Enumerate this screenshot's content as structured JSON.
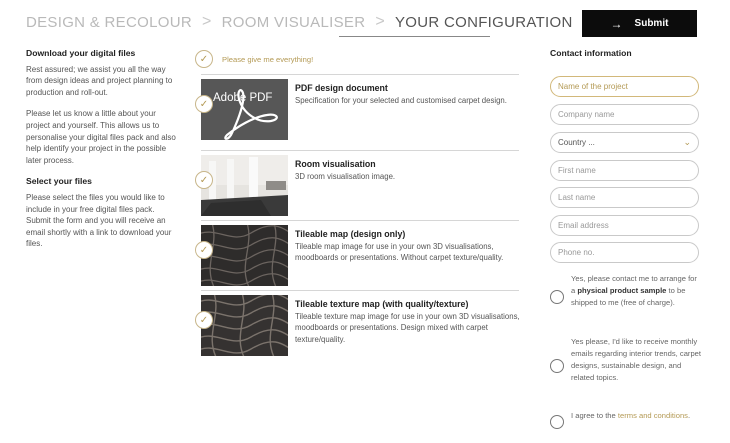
{
  "breadcrumb": {
    "steps": [
      "DESIGN & RECOLOUR",
      "ROOM VISUALISER",
      "YOUR CONFIGURATION"
    ],
    "separator": ">"
  },
  "submit": {
    "label": "Submit",
    "icon": "arrow-right-icon"
  },
  "left": {
    "heading_download": "Download your digital files",
    "para1": "Rest assured; we assist you all the way from design ideas and project planning to production and roll-out.",
    "para2": "Please let us know a little about your project and yourself. This allows us to personalise your digital files pack and also help identify your project in the possible later process.",
    "heading_select": "Select your files",
    "para3": "Please select the files you would like to include in your free digital files pack. Submit the form and you will receive an email shortly with a link to download your files."
  },
  "files": {
    "give_all": "Please give me everything!",
    "items": [
      {
        "title": "PDF design document",
        "desc": "Specification for your selected and customised carpet design.",
        "thumb_text": "Adobe PDF"
      },
      {
        "title": "Room visualisation",
        "desc": "3D room visualisation image."
      },
      {
        "title": "Tileable map (design only)",
        "desc": "Tileable map image for use in your own 3D visualisations, moodboards or presentations. Without carpet texture/quality."
      },
      {
        "title": "Tileable texture map (with quality/texture)",
        "desc": "Tileable texture map image for use in your own 3D visualisations, moodboards or presentations. Design mixed with carpet texture/quality."
      }
    ]
  },
  "contact": {
    "heading": "Contact information",
    "project_name": "Name of the project",
    "company_name": "Company name",
    "country": "Country ...",
    "first_name": "First name",
    "last_name": "Last name",
    "email": "Email address",
    "phone": "Phone no.",
    "optin1_pre": "Yes, please contact me to arrange for a",
    "optin1_bold": "physical product sample",
    "optin1_post": "to be shipped to me (free of charge).",
    "optin2": "Yes please, I'd like to receive monthly emails regarding interior trends, carpet designs, sustainable design, and related topics.",
    "optin3_pre": "I agree to the",
    "optin3_link": "terms and conditions",
    "optin3_post": "."
  },
  "colors": {
    "accent": "#b49a55",
    "button": "#0c0c0c"
  }
}
